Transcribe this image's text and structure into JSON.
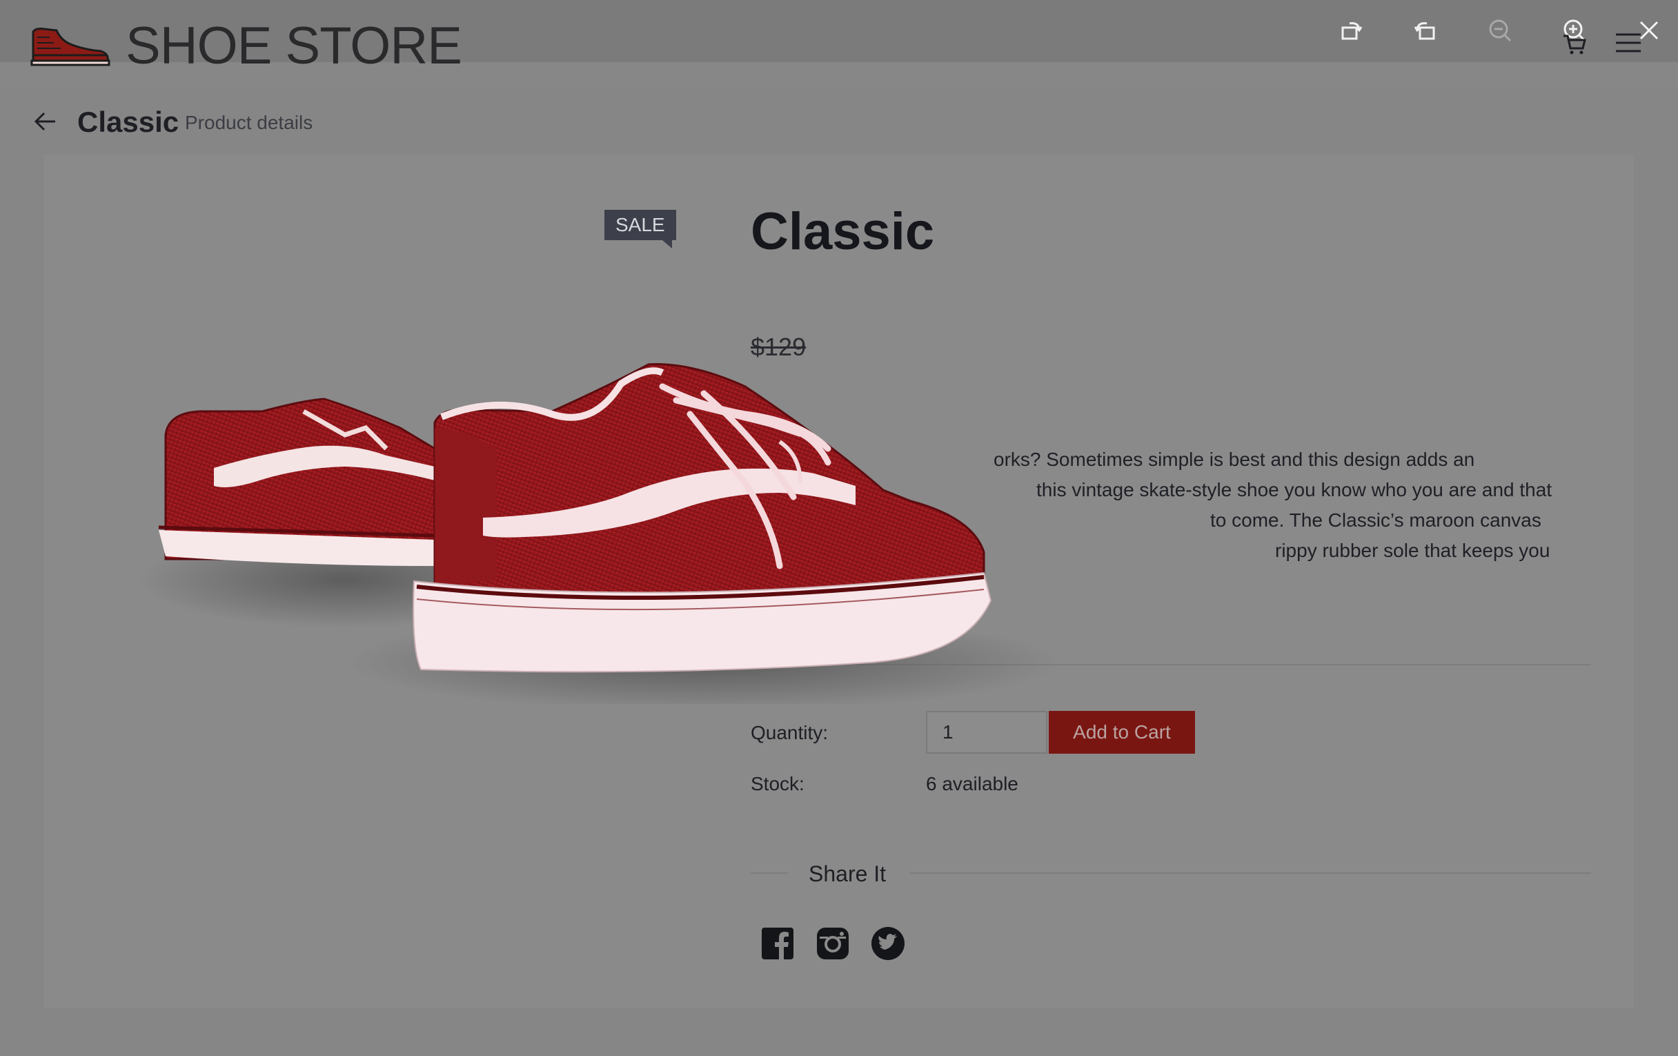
{
  "brand": {
    "name": "SHOE STORE",
    "logo_icon": "sneaker-logo-icon",
    "logo_color": "#8c1b15"
  },
  "viewer_toolbar": {
    "icons": [
      "rotate-left-icon",
      "rotate-right-icon",
      "zoom-out-icon",
      "zoom-in-icon",
      "close-icon"
    ]
  },
  "site_header": {
    "icons": [
      "cart-icon",
      "menu-icon"
    ]
  },
  "breadcrumb": {
    "back_icon": "arrow-left-icon",
    "title": "Classic",
    "subtitle": "Product details"
  },
  "product": {
    "badge": "SALE",
    "title": "Classic",
    "old_price": "$129",
    "description_visible": [
      "orks? Sometimes simple is best and this design adds an",
      "this vintage skate-style shoe you know who you are and that",
      "to come. The Classic’s maroon canvas",
      "rippy rubber sole that keeps you"
    ],
    "quantity_label": "Quantity:",
    "quantity_value": "1",
    "add_to_cart_label": "Add to Cart",
    "stock_label": "Stock:",
    "stock_value": "6 available",
    "share_title": "Share It",
    "share_icons": [
      "facebook-icon",
      "instagram-icon",
      "twitter-icon"
    ]
  },
  "colors": {
    "accent": "#7a1612",
    "shoe_red": "#9b1b1e",
    "overlay_gray": "#868686"
  }
}
